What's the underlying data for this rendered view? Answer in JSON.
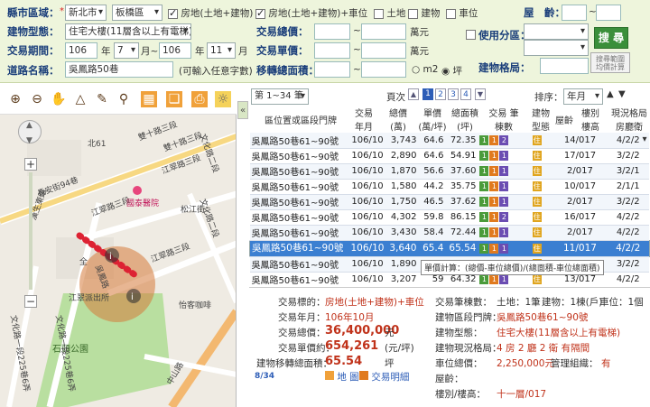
{
  "filter": {
    "county_label": "縣市區域：",
    "county_value": "新北市",
    "district_value": "板橋區",
    "cb_land_bldg": "房地(土地+建物)",
    "cb_land_bldg_park": "房地(土地+建物)+車位",
    "cb_land": "土地",
    "cb_bldg": "建物",
    "cb_park": "車位",
    "age_label": "屋　齡：",
    "type_label": "建物型態：",
    "type_value": "住宅大樓(11層含以上有電梯)",
    "total_label": "交易總價：",
    "total_unit": "萬元",
    "zoning_label": "使用分區：",
    "search_label": "搜 尋",
    "reset_label": "搜尋範圍 均價計算",
    "period_label": "交易期間：",
    "year_from": "106",
    "month_from": "7",
    "year_to": "106",
    "month_to": "11",
    "year_unit": "年",
    "month_unit": "月",
    "tilde": "~",
    "unit_label": "交易單價：",
    "unit_unit": "萬元",
    "road_label": "道路名稱：",
    "road_value": "吳鳳路50巷",
    "road_hint": "(可輸入任意字數)",
    "move_label": "移轉總面積：",
    "area_m2": "m2",
    "area_ping": "坪",
    "layout_label": "建物格局："
  },
  "map": {
    "streets": [
      "雙十路三段",
      "雙十路三段",
      "江翠路三段",
      "江翠路三段",
      "江翠路三段",
      "文化路二段",
      "文化路二段",
      "松江街",
      "吳鳳路",
      "漢生東路",
      "長安街94巷",
      "北61",
      "怡客咖啡",
      "江翠派出所",
      "國泰醫院",
      "石頭公園",
      "文化路一段225巷6弄",
      "文化路一段225巷6弄",
      "中山路",
      "全"
    ],
    "zoom_plus": "+",
    "zoom_minus": "−",
    "collapse": "«"
  },
  "results": {
    "range_label": "第 1~34 筆",
    "page_label": "頁次",
    "pages": [
      "1",
      "2",
      "3",
      "4"
    ],
    "sort_label": "排序：",
    "sort_value": "年月",
    "headers": {
      "addr": "區位置或區段門牌",
      "date": "交易 年月",
      "total": "總價 (萬)",
      "unit": "單價 (萬/坪)",
      "area": "總面積 (坪)",
      "count": "交易 筆棟數",
      "btype": "建物 型態",
      "age": "屋齡",
      "floor": "樓別 樓高",
      "layout": "現況格局 房廳衛"
    },
    "rows": [
      {
        "addr": "吳鳳路50巷61~90號",
        "date": "106/10",
        "total": "3,743",
        "unit": "64.6",
        "area": "72.35",
        "c1": "1",
        "c2": "1",
        "c3": "2",
        "floor": "14/017",
        "layout": "4/2/2"
      },
      {
        "addr": "吳鳳路50巷61~90號",
        "date": "106/10",
        "total": "2,890",
        "unit": "64.6",
        "area": "54.91",
        "c1": "1",
        "c2": "1",
        "c3": "1",
        "floor": "17/017",
        "layout": "3/2/2"
      },
      {
        "addr": "吳鳳路50巷61~90號",
        "date": "106/10",
        "total": "1,870",
        "unit": "56.6",
        "area": "37.60",
        "c1": "1",
        "c2": "1",
        "c3": "1",
        "floor": "2/017",
        "layout": "3/2/1"
      },
      {
        "addr": "吳鳳路50巷61~90號",
        "date": "106/10",
        "total": "1,580",
        "unit": "44.2",
        "area": "35.75",
        "c1": "1",
        "c2": "1",
        "c3": "1",
        "floor": "10/017",
        "layout": "2/1/1"
      },
      {
        "addr": "吳鳳路50巷61~90號",
        "date": "106/10",
        "total": "1,750",
        "unit": "46.5",
        "area": "37.62",
        "c1": "1",
        "c2": "1",
        "c3": "1",
        "floor": "2/017",
        "layout": "3/2/2"
      },
      {
        "addr": "吳鳳路50巷61~90號",
        "date": "106/10",
        "total": "4,302",
        "unit": "59.8",
        "area": "86.15",
        "c1": "1",
        "c2": "1",
        "c3": "2",
        "floor": "16/017",
        "layout": "4/2/2"
      },
      {
        "addr": "吳鳳路50巷61~90號",
        "date": "106/10",
        "total": "3,430",
        "unit": "58.4",
        "area": "72.44",
        "c1": "1",
        "c2": "1",
        "c3": "1",
        "floor": "2/017",
        "layout": "4/2/2"
      },
      {
        "addr": "吳鳳路50巷61~90號",
        "date": "106/10",
        "total": "3,640",
        "unit": "65.4",
        "area": "65.54",
        "c1": "1",
        "c2": "1",
        "c3": "1",
        "floor": "11/017",
        "layout": "4/2/2"
      },
      {
        "addr": "吳鳳路50巷61~90號",
        "date": "106/10",
        "total": "1,890",
        "unit": "",
        "area": "",
        "c1": "",
        "c2": "",
        "c3": "",
        "floor": "2/017",
        "layout": "3/2/2"
      },
      {
        "addr": "吳鳳路50巷61~90號",
        "date": "106/10",
        "total": "3,207",
        "unit": "59",
        "area": "64.32",
        "c1": "1",
        "c2": "1",
        "c3": "1",
        "floor": "13/017",
        "layout": "4/2/2"
      }
    ],
    "type_badge": "住",
    "tooltip": "單價計算：(總價-車位總價)/(總面積-車位總面積)"
  },
  "detail": {
    "l_target": "交易標的：",
    "v_target": "房地(土地+建物)+車位",
    "l_date": "交易年月：",
    "v_date": "106年10月",
    "l_total": "交易總價：",
    "v_total": "36,400,000",
    "u_total": "元",
    "l_unit": "交易單價約：",
    "v_unit": "654,261",
    "u_unit": "(元/坪)",
    "l_area": "建物移轉總面積：",
    "v_area": "65.54",
    "u_area": "坪",
    "counter": "8/34",
    "map_link": "地 圖",
    "detail_link": "交易明細",
    "l_count": "交易筆棟數：",
    "v_count_land": "土地：1筆",
    "v_count_bldg": "建物：1棟(戶)",
    "v_count_park": "車位：1個",
    "l_addr": "建物區段門牌：",
    "v_addr": "吳鳳路50巷61~90號",
    "l_btype": "建物型態：",
    "v_btype": "住宅大樓(11層含以上有電梯)",
    "l_layout": "建物現況格局：",
    "v_layout": "4 房 2 廳 2 衛 有隔間",
    "l_park": "車位總價：",
    "v_park": "2,250,000元",
    "l_mgmt": "管理組織：",
    "v_mgmt": "有",
    "l_age": "屋齡：",
    "l_floor": "樓別/樓高：",
    "v_floor": "十一層/017"
  }
}
